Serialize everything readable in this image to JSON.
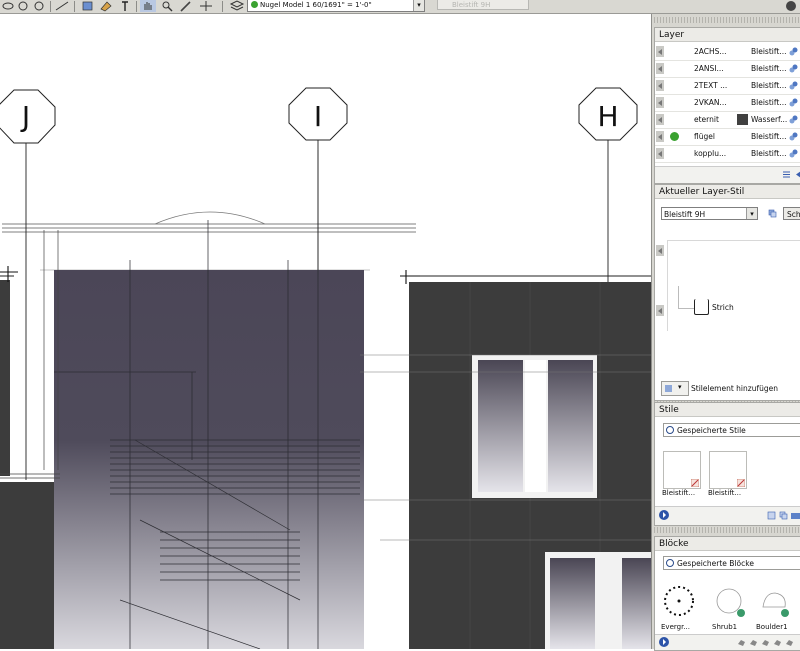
{
  "toolbar": {
    "layer_dropdown_value": "Nugel  Model 1  60/1691\" = 1'-0\"",
    "style_button_label": "Bleistift 9H",
    "icons": [
      "lasso-icon",
      "ellipse-icon",
      "circle-icon",
      "line-icon",
      "push-pull-icon",
      "paint-icon",
      "text-icon",
      "hand-icon",
      "zoom-icon",
      "brush-icon",
      "layer-stack-icon"
    ]
  },
  "drawing": {
    "gridlines": [
      {
        "label": "J"
      },
      {
        "label": "I"
      },
      {
        "label": "H"
      }
    ]
  },
  "layer_panel": {
    "title": "Layer",
    "rows": [
      {
        "name": "2ACHS...",
        "style": "Bleistift...",
        "active": false,
        "swatch": false
      },
      {
        "name": "2ANSI...",
        "style": "Bleistift...",
        "active": false,
        "swatch": false
      },
      {
        "name": "2TEXT ...",
        "style": "Bleistift...",
        "active": false,
        "swatch": false
      },
      {
        "name": "2VKAN...",
        "style": "Bleistift...",
        "active": false,
        "swatch": false
      },
      {
        "name": "eternit",
        "style": "Wasserf...",
        "active": false,
        "swatch": true
      },
      {
        "name": "flügel",
        "style": "Bleistift...",
        "active": true,
        "swatch": false
      },
      {
        "name": "kopplu...",
        "style": "Bleistift...",
        "active": false,
        "swatch": false
      }
    ]
  },
  "layer_style_panel": {
    "title": "Aktueller Layer-Stil",
    "style_select": "Bleistift 9H",
    "side_button": "Sch",
    "tree_item": "Strich",
    "add_element": "Stilelement hinzufügen"
  },
  "styles_panel": {
    "title": "Stile",
    "search_placeholder": "Gespeicherte Stile",
    "items": [
      {
        "label": "Bleistift..."
      },
      {
        "label": "Bleistift..."
      }
    ]
  },
  "blocks_panel": {
    "title": "Blöcke",
    "search_placeholder": "Gespeicherte Blöcke",
    "items": [
      {
        "label": "Evergr..."
      },
      {
        "label": "Shrub1"
      },
      {
        "label": "Boulder1"
      }
    ]
  },
  "colors": {
    "wall_dark": "#3c3c3c",
    "glass_panel": "#4a4654",
    "panel_bg": "#d7d6d0",
    "accent_blue": "#2d54a8",
    "check_green": "#3aa230"
  }
}
